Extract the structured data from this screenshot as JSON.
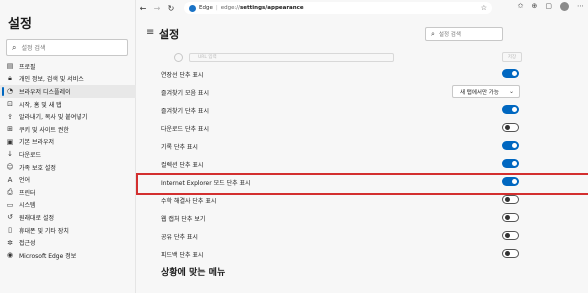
{
  "sidebar": {
    "title": "설정",
    "search_placeholder": "설정 검색",
    "items": [
      {
        "icon": "profile-icon",
        "glyph": "▤",
        "label": "프로필"
      },
      {
        "icon": "lock-icon",
        "glyph": "🔒︎",
        "label": "개인 정보, 검색 및 서비스"
      },
      {
        "icon": "appearance-icon",
        "glyph": "◔",
        "label": "브라우저 디스플레이",
        "active": true
      },
      {
        "icon": "home-icon",
        "glyph": "⊡",
        "label": "시작, 홈 및 새 탭"
      },
      {
        "icon": "share-icon",
        "glyph": "⇪",
        "label": "알라내기, 복사 및 붙여넣기"
      },
      {
        "icon": "cookies-icon",
        "glyph": "⊞",
        "label": "쿠키 및 사이트 권한"
      },
      {
        "icon": "default-browser-icon",
        "glyph": "▣",
        "label": "기본 브라우저"
      },
      {
        "icon": "download-icon",
        "glyph": "↓",
        "label": "다운로드"
      },
      {
        "icon": "family-icon",
        "glyph": "☺",
        "label": "가족 보호 설정"
      },
      {
        "icon": "language-icon",
        "glyph": "A",
        "label": "언어"
      },
      {
        "icon": "printer-icon",
        "glyph": "⎙",
        "label": "프린터"
      },
      {
        "icon": "system-icon",
        "glyph": "▭",
        "label": "시스템"
      },
      {
        "icon": "reset-icon",
        "glyph": "↺",
        "label": "원래대로 설정"
      },
      {
        "icon": "phone-icon",
        "glyph": "▯",
        "label": "휴대폰 및 기타 장치"
      },
      {
        "icon": "accessibility-icon",
        "glyph": "✲",
        "label": "접근성"
      },
      {
        "icon": "edge-icon",
        "glyph": "◉",
        "label": "Microsoft Edge 정보"
      }
    ]
  },
  "browser": {
    "chip": "Edge",
    "url_base": "edge://",
    "url_path": "settings/appearance"
  },
  "main": {
    "title": "설정",
    "search_placeholder": "설정 검색",
    "ghost_input": "URL 입력",
    "ghost_button": "저장",
    "rows": [
      {
        "label": "연장선 단추 표시",
        "control": "toggle",
        "on": true
      },
      {
        "label": "즐겨찾기 모음 표시",
        "control": "select",
        "value": "새 탭에서만 가능"
      },
      {
        "label": "즐겨찾기 단추 표시",
        "control": "toggle",
        "on": true
      },
      {
        "label": "다운로드 단추 표시",
        "control": "toggle",
        "on": false
      },
      {
        "label": "기록 단추 표시",
        "control": "toggle",
        "on": true
      },
      {
        "label": "컬렉션 단추 표시",
        "control": "toggle",
        "on": true
      },
      {
        "label": "Internet Explorer 모드 단추 표시",
        "control": "toggle",
        "on": true,
        "highlight": true
      },
      {
        "label": "수학 해결사 단추 표시",
        "control": "toggle",
        "on": false
      },
      {
        "label": "웹 캡처 단추 보기",
        "control": "toggle",
        "on": false
      },
      {
        "label": "공유 단추 표시",
        "control": "toggle",
        "on": false
      },
      {
        "label": "피드백 단추 표시",
        "control": "toggle",
        "on": false
      }
    ],
    "section_title": "상황에 맞는 메뉴"
  },
  "colors": {
    "accent": "#0067c0",
    "highlight_border": "#d32f2f"
  }
}
